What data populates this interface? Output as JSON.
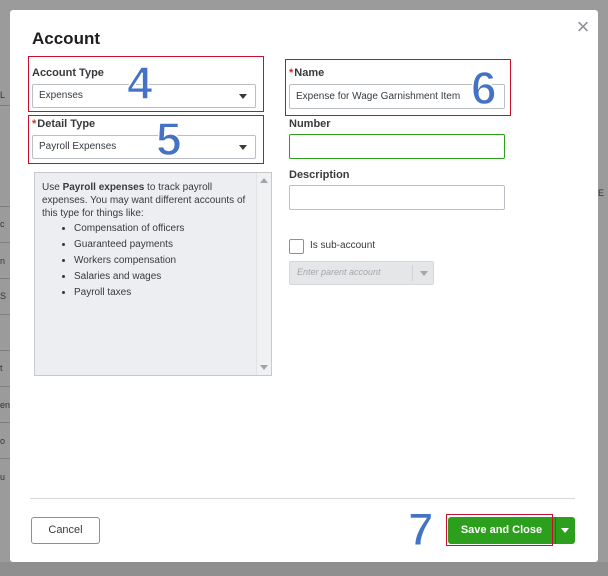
{
  "dialog": {
    "title": "Account",
    "close_glyph": "×",
    "icons": {
      "close": "close-icon",
      "dropdown": "chevron-down-icon"
    }
  },
  "account_type": {
    "label": "Account Type",
    "value": "Expenses"
  },
  "detail_type": {
    "label": "Detail Type",
    "value": "Payroll Expenses",
    "required_mark": "*"
  },
  "name": {
    "label": "Name",
    "value": "Expense for Wage Garnishment Item",
    "required_mark": "*"
  },
  "number": {
    "label": "Number",
    "value": ""
  },
  "description": {
    "label": "Description",
    "value": ""
  },
  "help": {
    "intro_pre": "Use ",
    "intro_bold": "Payroll expenses",
    "intro_post": " to track payroll expenses. You may want different accounts of this type for things like:",
    "items": [
      "Compensation of officers",
      "Guaranteed payments",
      "Workers compensation",
      "Salaries and wages",
      "Payroll taxes"
    ]
  },
  "sub_account": {
    "label": "Is sub-account",
    "checked": false,
    "placeholder": "Enter parent account"
  },
  "footer": {
    "cancel_label": "Cancel",
    "save_label": "Save and Close"
  },
  "annotations": {
    "n4": "4",
    "n5": "5",
    "n6": "6",
    "n7": "7",
    "color": "#4472c4",
    "box_color": "#c8102e"
  },
  "colors": {
    "primary": "#2ca01c",
    "required": "#d52b1e"
  },
  "background": {
    "left_fragments": [
      "L",
      "c",
      "n",
      "S",
      "t",
      "en",
      "o",
      "u"
    ],
    "right_fragments": [
      "E"
    ]
  }
}
